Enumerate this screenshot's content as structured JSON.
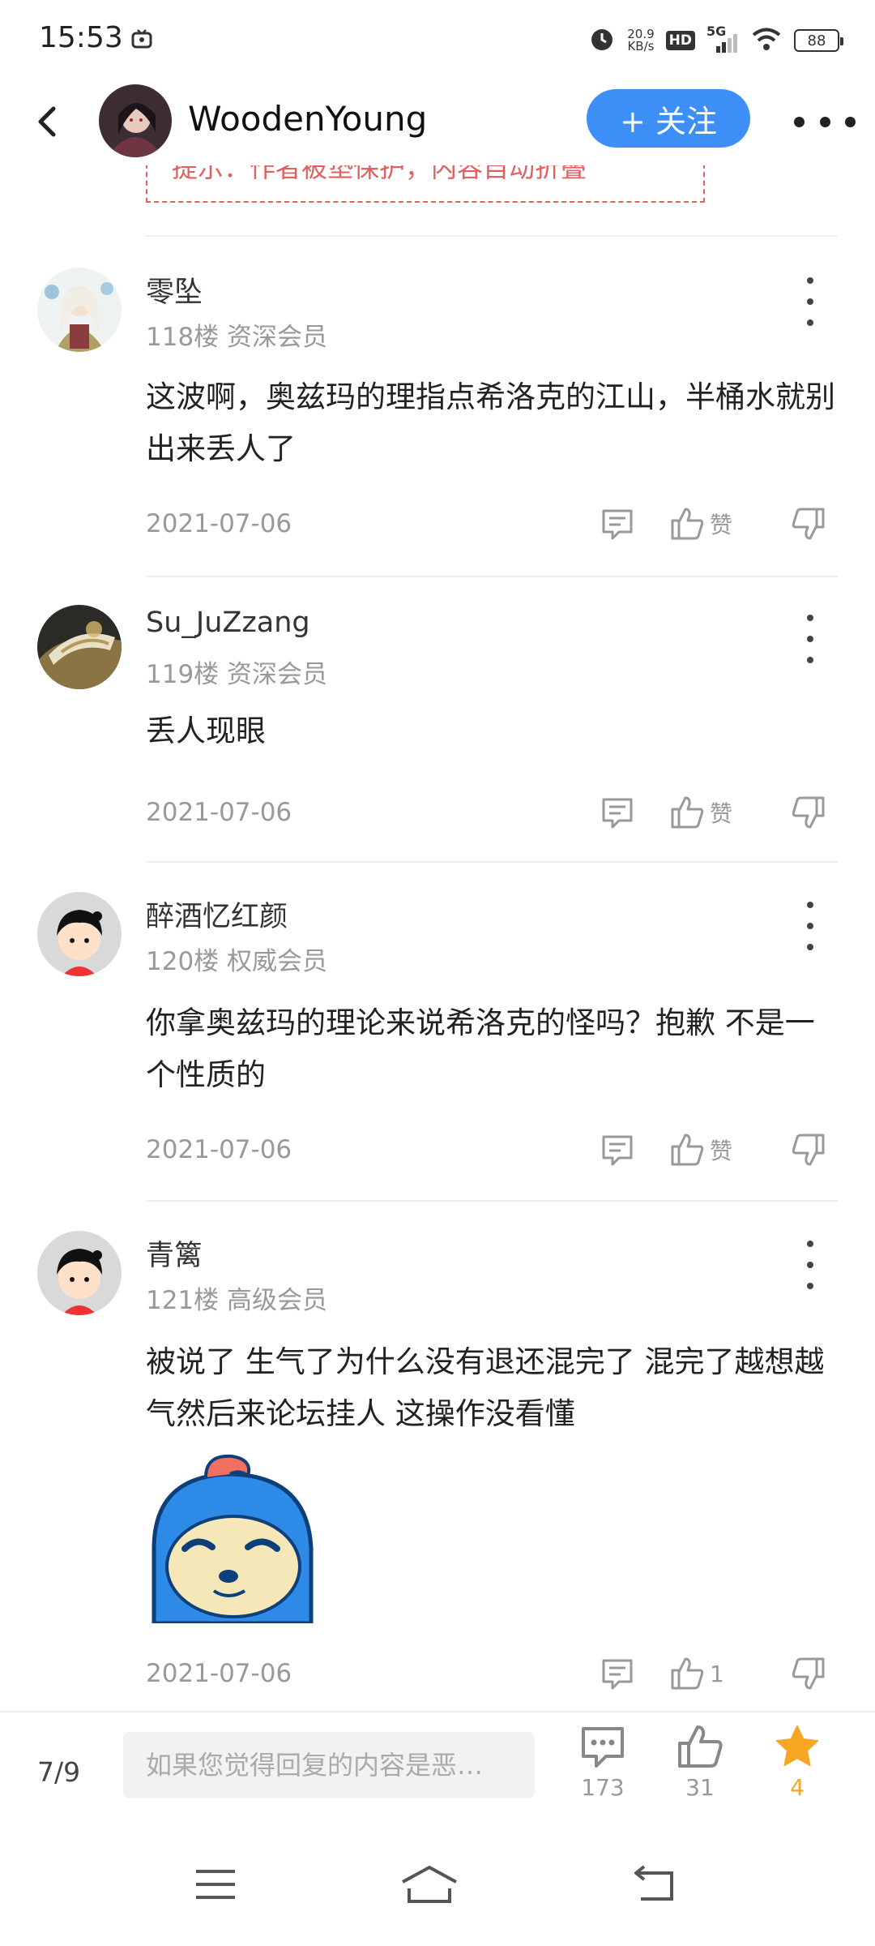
{
  "status_bar": {
    "time": "15:53",
    "net_speed_value": "20.9",
    "net_speed_unit": "KB/s",
    "hd": "HD",
    "network": "5G",
    "battery": "88"
  },
  "header": {
    "username": "WoodenYoung",
    "follow_label": "+ 关注"
  },
  "notice": {
    "text": "提示：作者被垫保护，内容自动折叠"
  },
  "comments": [
    {
      "name": "零坠",
      "meta": "118楼 资深会员",
      "body": "这波啊，奥兹玛的理指点希洛克的江山，半桶水就别出来丢人了",
      "date": "2021-07-06",
      "like_label": "赞"
    },
    {
      "name": "Su_JuZzang",
      "meta": "119楼 资深会员",
      "body": "丢人现眼",
      "date": "2021-07-06",
      "like_label": "赞"
    },
    {
      "name": "醉酒忆红颜",
      "meta": "120楼 权威会员",
      "body": "你拿奥兹玛的理论来说希洛克的怪吗？抱歉 不是一个性质的",
      "date": "2021-07-06",
      "like_label": "赞"
    },
    {
      "name": "青篱",
      "meta": "121楼 高级会员",
      "body": "被说了 生气了为什么没有退还混完了 混完了越想越气然后来论坛挂人 这操作没看懂",
      "date": "2021-07-06",
      "like_label": "1"
    }
  ],
  "bottom_bar": {
    "page_indicator": "7/9",
    "reply_placeholder": "如果您觉得回复的内容是恶…",
    "comment_count": "173",
    "like_count": "31",
    "favorite_count": "4"
  },
  "colors": {
    "accent": "#3e8ef7",
    "favorite": "#f5a623",
    "notice": "#e06060"
  }
}
